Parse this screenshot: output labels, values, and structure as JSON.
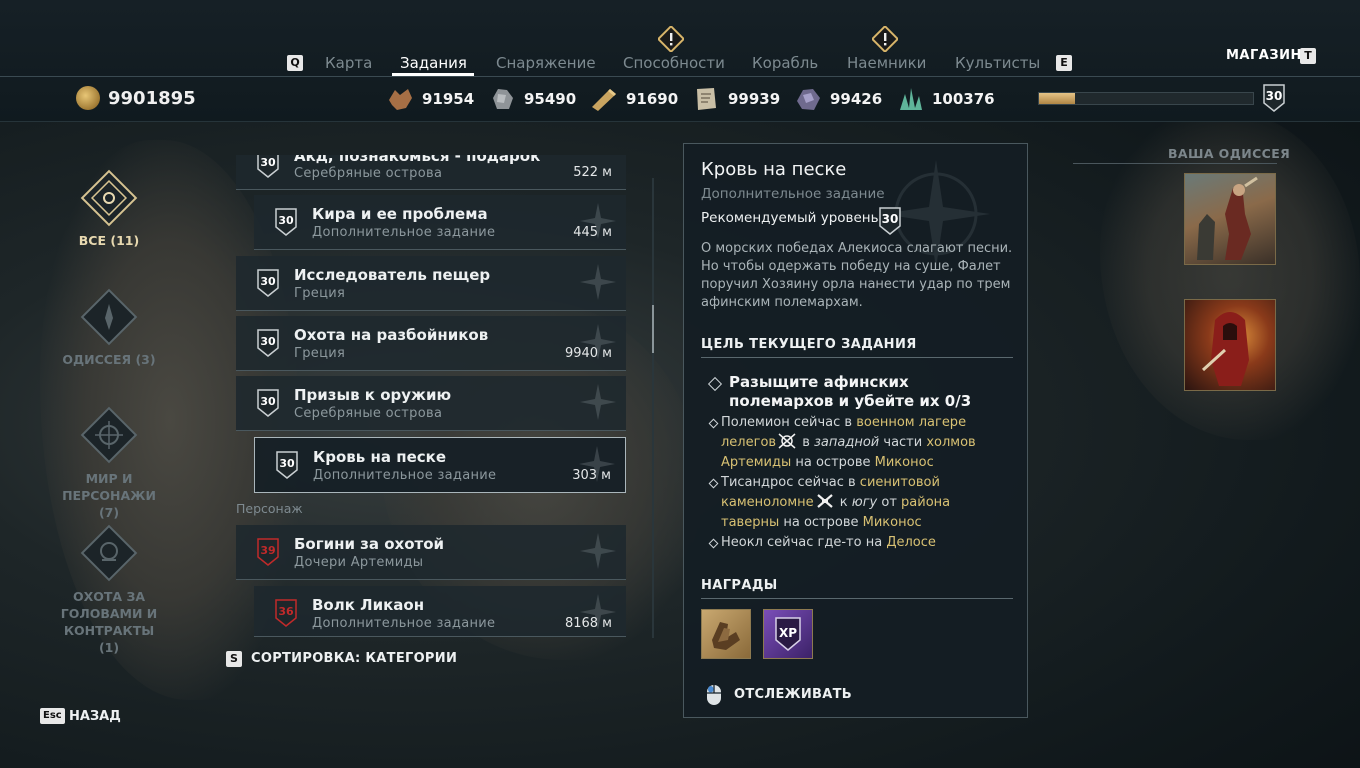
{
  "colors": {
    "accent": "#d8c173",
    "active_tab": "#ffffff",
    "inactive_tab": "#7d8a90",
    "badge_red": "#c02a2a"
  },
  "nav": {
    "left_key": "Q",
    "right_key": "E",
    "tabs": [
      {
        "label": "Карта"
      },
      {
        "label": "Задания"
      },
      {
        "label": "Снаряжение"
      },
      {
        "label": "Способности"
      },
      {
        "label": "Корабль"
      },
      {
        "label": "Наемники"
      },
      {
        "label": "Культисты"
      }
    ],
    "active_tab": "Задания",
    "shop_label": "МАГАЗИН",
    "shop_key": "T"
  },
  "currency": {
    "drachma": "9901895"
  },
  "resources": [
    {
      "icon": "leather-icon",
      "value": "91954"
    },
    {
      "icon": "iron-ore-icon",
      "value": "95490"
    },
    {
      "icon": "wood-icon",
      "value": "91690"
    },
    {
      "icon": "ancient-tablet-icon",
      "value": "99939"
    },
    {
      "icon": "obsidian-icon",
      "value": "99426"
    },
    {
      "icon": "crystal-icon",
      "value": "100376"
    }
  ],
  "player": {
    "level": "30",
    "xp_progress": 0.17
  },
  "categories": [
    {
      "label": "ВСЕ (11)",
      "icon": "all-quests-icon",
      "active": true
    },
    {
      "label": "ОДИССЕЯ (3)",
      "icon": "odyssey-icon",
      "active": false
    },
    {
      "label": "МИР И ПЕРСОНАЖИ (7)",
      "icon": "world-characters-icon",
      "active": false
    },
    {
      "label": "ОХОТА ЗА ГОЛОВАМИ И КОНТРАКТЫ (1)",
      "icon": "bounty-icon",
      "active": false
    }
  ],
  "quests": [
    {
      "title": "Акд, познакомься - подарок",
      "subtitle": "Серебряные острова",
      "distance": "522 м",
      "level": "30"
    },
    {
      "title": "Кира и ее проблема",
      "subtitle": "Дополнительное задание",
      "distance": "445 м",
      "level": "30"
    },
    {
      "title": "Исследователь пещер",
      "subtitle": "Греция",
      "distance": "",
      "level": "30"
    },
    {
      "title": "Охота на разбойников",
      "subtitle": "Греция",
      "distance": "9940 м",
      "level": "30"
    },
    {
      "title": "Призыв к оружию",
      "subtitle": "Серебряные острова",
      "distance": "",
      "level": "30"
    },
    {
      "title": "Кровь на песке",
      "subtitle": "Дополнительное задание",
      "distance": "303 м",
      "level": "30"
    }
  ],
  "section_label": "Персонаж",
  "character_quests": [
    {
      "title": "Богини за охотой",
      "subtitle": "Дочери Артемиды",
      "distance": "",
      "level": "39"
    },
    {
      "title": "Волк Ликаон",
      "subtitle": "Дополнительное задание",
      "distance": "8168 м",
      "level": "36"
    }
  ],
  "sort": {
    "key": "S",
    "label": "СОРТИРОВКА: КАТЕГОРИИ"
  },
  "back": {
    "key": "Esc",
    "label": "НАЗАД"
  },
  "detail": {
    "title": "Кровь на песке",
    "type": "Дополнительное задание",
    "recommended_label": "Рекомендуемый уровень",
    "recommended_level": "30",
    "description": "О морских победах Алекиоса слагают песни. Но чтобы одержать победу на суше, Фалет поручил Хозяину орла нанести удар по трем афинским полемархам.",
    "objective_heading": "ЦЕЛЬ ТЕКУЩЕГО ЗАДАНИЯ",
    "objective": "Разыщите афинских полемархов и убейте их 0/3",
    "hints": [
      {
        "a": "Полемион сейчас в ",
        "b": "военном лагере лелегов",
        "c": " в ",
        "d": "западной",
        "e": " части ",
        "f": "холмов Артемиды",
        "g": " на острове ",
        "h": "Миконос"
      },
      {
        "a": "Тисандрос сейчас в ",
        "b": "сиенитовой каменоломне",
        "c": " к ",
        "d": "югу",
        "e": " от ",
        "f": "района таверны",
        "g": " на острове ",
        "h": "Миконос"
      },
      {
        "a": "Неокл сейчас где-то на ",
        "b": "Делосе"
      }
    ],
    "rewards_heading": "НАГРАДЫ",
    "rewards": [
      {
        "icon": "gauntlets-icon"
      },
      {
        "icon": "xp-icon",
        "label": "XP"
      }
    ],
    "track_label": "ОТСЛЕЖИВАТЬ"
  },
  "odyssey": {
    "heading": "ВАША ОДИССЕЯ"
  }
}
